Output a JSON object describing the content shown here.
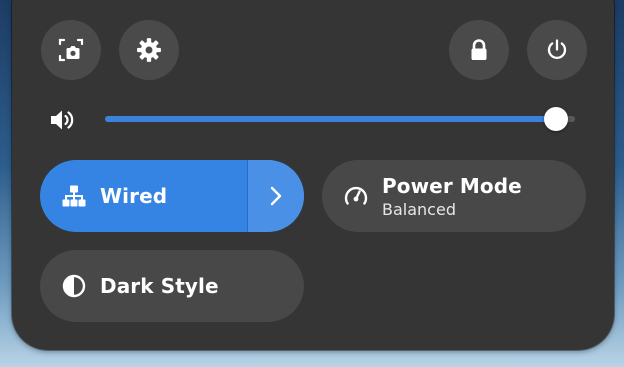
{
  "top_row": {
    "screenshot_icon": "camera-screenshot-icon",
    "settings_icon": "gear-icon",
    "lock_icon": "lock-icon",
    "power_icon": "power-icon"
  },
  "volume": {
    "icon": "speaker-icon",
    "level": 0.96
  },
  "toggles": {
    "wired": {
      "label": "Wired",
      "icon": "network-wired-icon",
      "active": true,
      "color": "#3584e4"
    },
    "power_mode": {
      "label": "Power Mode",
      "sublabel": "Balanced",
      "icon": "speedometer-icon"
    },
    "dark_style": {
      "label": "Dark Style",
      "icon": "half-circle-icon"
    }
  }
}
